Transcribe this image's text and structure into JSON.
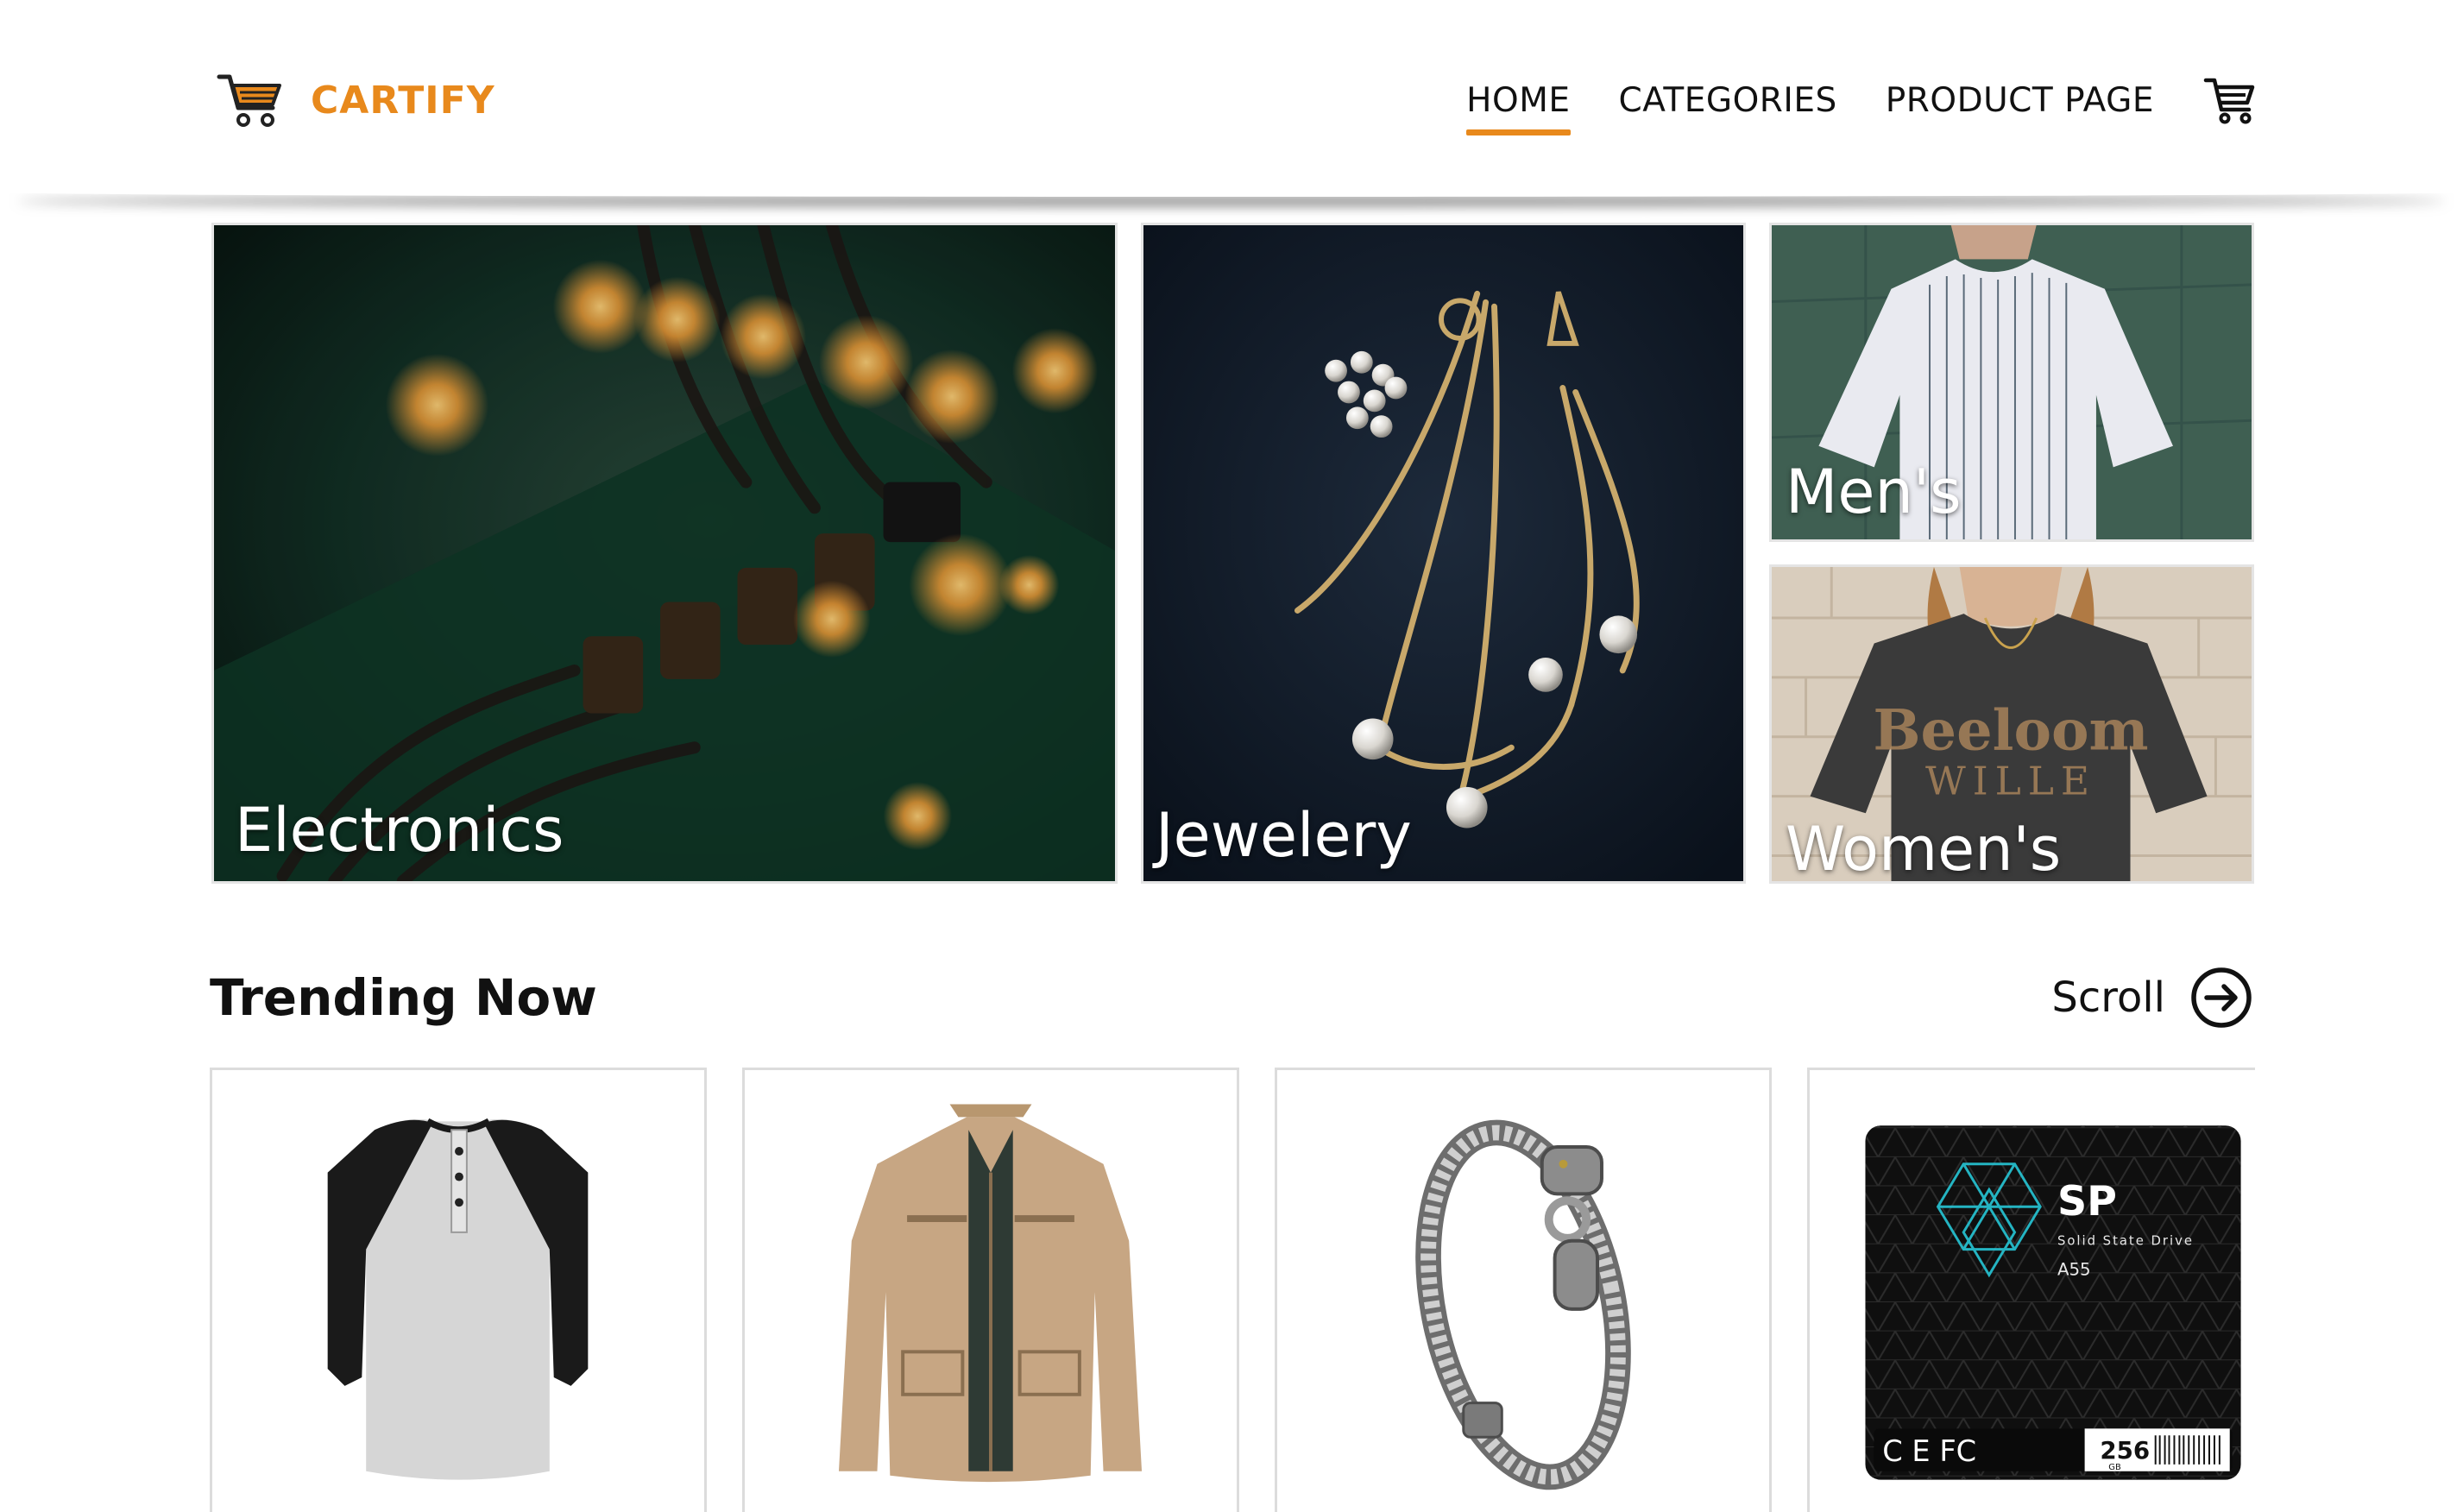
{
  "brand": {
    "name": "CARTIFY",
    "logo_icon": "shopping-cart-icon",
    "accent_color": "#e8891c"
  },
  "nav": {
    "items": [
      {
        "label": "HOME",
        "active": true
      },
      {
        "label": "CATEGORIES",
        "active": false
      },
      {
        "label": "PRODUCT PAGE",
        "active": false
      }
    ],
    "cart_icon": "cart-icon"
  },
  "categories": [
    {
      "label": "Electronics"
    },
    {
      "label": "Jewelery"
    },
    {
      "label": "Men's"
    },
    {
      "label": "Women's"
    }
  ],
  "trending": {
    "title": "Trending Now",
    "scroll_label": "Scroll",
    "scroll_icon": "arrow-right-circle-icon",
    "products": [
      {
        "image": "raglan-henley-shirt"
      },
      {
        "image": "khaki-jacket"
      },
      {
        "image": "silver-dragon-bracelet"
      },
      {
        "image": "ssd-drive",
        "brand_text": "SP",
        "line1": "Solid State Drive",
        "model": "A55",
        "capacity": "256",
        "unit": "GB"
      }
    ]
  }
}
